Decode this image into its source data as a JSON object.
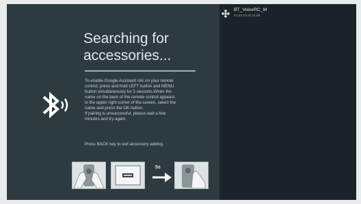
{
  "pairing": {
    "title": "Searching for\naccessories...",
    "progress": 1.0,
    "instructions": "To enable Google Assistant mic on your remote\ncontrol, press and hold LEFT button and MENU\nbutton simultaneously for 5 seconds.When the\nname on the back of the remote control appears\nin the upper right corner of the screen, select the\nname and press the OK button.\nIf pairing is unsuccessful, please wait a few\nminutes and try again.",
    "back_hint": "Press BACK key to exit accessory adding.",
    "step_timer": "5s",
    "icon": "bluetooth-icon"
  },
  "devices": [
    {
      "name": "BT_VoiceRC_M",
      "address": "41:33:10:31:11:08",
      "icon": "bluetooth-device-icon"
    }
  ],
  "colors": {
    "panel_left": "#2d3b41",
    "panel_right": "#1a2428",
    "text": "#e3e7e8",
    "progress": "#9fb2b6"
  }
}
